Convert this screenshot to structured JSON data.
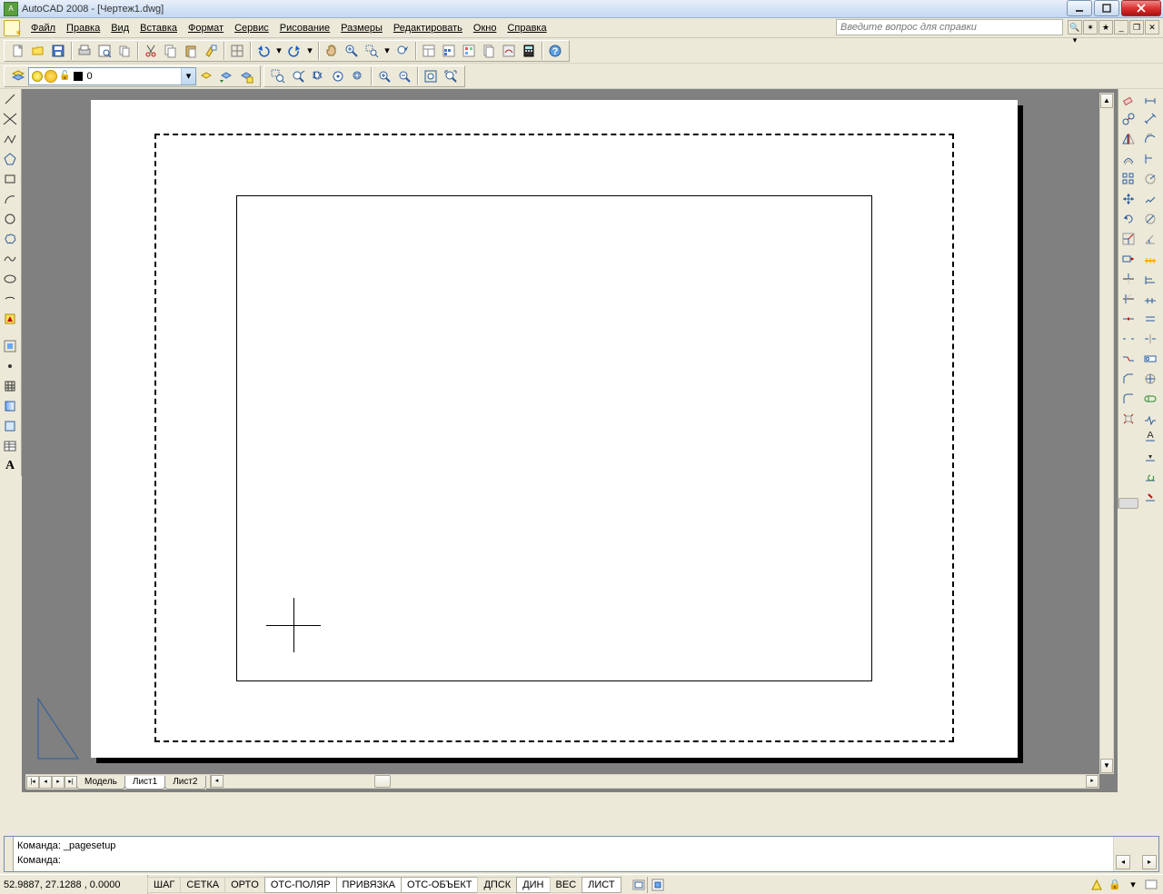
{
  "window": {
    "title": "AutoCAD 2008 - [Чертеж1.dwg]"
  },
  "menu": {
    "file": "Файл",
    "edit": "Правка",
    "view": "Вид",
    "insert": "Вставка",
    "format": "Формат",
    "tools": "Сервис",
    "draw": "Рисование",
    "dimension": "Размеры",
    "modify": "Редактировать",
    "window": "Окно",
    "help": "Справка"
  },
  "help_search": {
    "placeholder": "Введите вопрос для справки"
  },
  "layer": {
    "current": "0"
  },
  "tabs": {
    "model": "Модель",
    "layout1": "Лист1",
    "layout2": "Лист2"
  },
  "command": {
    "line1": "Команда: _pagesetup",
    "line2": "Команда:"
  },
  "status": {
    "coords": "52.9887, 27.1288 , 0.0000",
    "snap": "ШАГ",
    "grid": "СЕТКА",
    "ortho": "ОРТO",
    "polar": "ОТС-ПОЛЯР",
    "osnap": "ПРИВЯЗКА",
    "otrack": "ОТС-ОБЪЕКТ",
    "ducs": "ДПСК",
    "dyn": "ДИН",
    "lwt": "ВЕС",
    "paper": "ЛИСТ",
    "polar_on": true,
    "osnap_on": true,
    "otrack_on": true,
    "dyn_on": true,
    "paper_on": true
  }
}
